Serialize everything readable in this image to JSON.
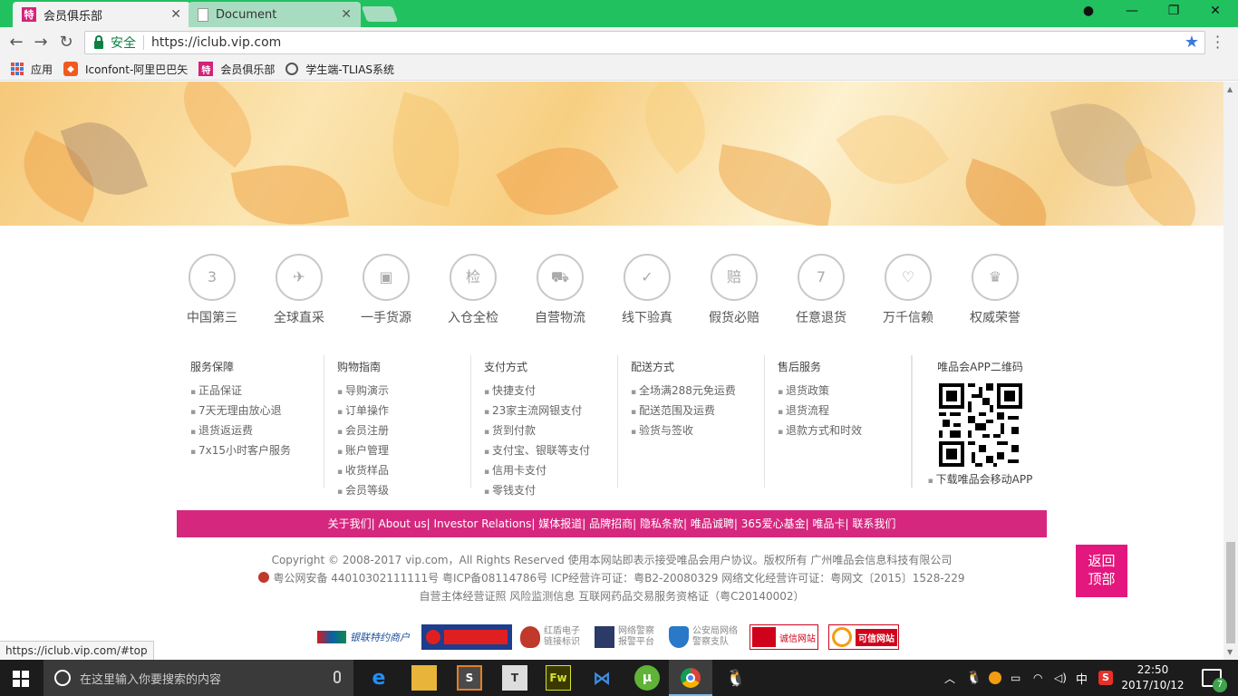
{
  "browser": {
    "tabs": [
      {
        "label": "会员俱乐部",
        "favicon": "vip-favicon",
        "favicon_text": "特"
      },
      {
        "label": "Document",
        "favicon": "document-icon"
      }
    ],
    "security_label": "安全",
    "url": "https://iclub.vip.com",
    "bookmarks": [
      {
        "label": "应用",
        "icon": "apps-grid-icon"
      },
      {
        "label": "Iconfont-阿里巴巴矢",
        "icon": "iconfont-icon"
      },
      {
        "label": "会员俱乐部",
        "icon": "vip-favicon",
        "icon_text": "特"
      },
      {
        "label": "学生端-TLIAS系统",
        "icon": "tlias-icon"
      }
    ],
    "status_url": "https://iclub.vip.com/#top"
  },
  "services": [
    {
      "label": "中国第三",
      "icon": "badge-3-icon",
      "glyph": "3"
    },
    {
      "label": "全球直采",
      "icon": "plane-globe-icon",
      "glyph": "✈"
    },
    {
      "label": "一手货源",
      "icon": "box-icon",
      "glyph": "▣"
    },
    {
      "label": "入仓全检",
      "icon": "inspect-magnifier-icon",
      "glyph": "检"
    },
    {
      "label": "自营物流",
      "icon": "truck-icon",
      "glyph": "⛟"
    },
    {
      "label": "线下验真",
      "icon": "document-check-icon",
      "glyph": "✓"
    },
    {
      "label": "假货必赔",
      "icon": "shield-compensate-icon",
      "glyph": "赔"
    },
    {
      "label": "任意退货",
      "icon": "return-7-icon",
      "glyph": "7"
    },
    {
      "label": "万千信赖",
      "icon": "heart-icon",
      "glyph": "♡"
    },
    {
      "label": "权威荣誉",
      "icon": "trophy-icon",
      "glyph": "♛"
    }
  ],
  "footer_columns": [
    {
      "title": "服务保障",
      "items": [
        "正品保证",
        "7天无理由放心退",
        "退货返运费",
        "7x15小时客户服务"
      ]
    },
    {
      "title": "购物指南",
      "items": [
        "导购演示",
        "订单操作",
        "会员注册",
        "账户管理",
        "收货样品",
        "会员等级"
      ]
    },
    {
      "title": "支付方式",
      "items": [
        "快捷支付",
        "23家主流网银支付",
        "货到付款",
        "支付宝、银联等支付",
        "信用卡支付",
        "零钱支付"
      ]
    },
    {
      "title": "配送方式",
      "items": [
        "全场满288元免运费",
        "配送范围及运费",
        "验货与签收"
      ]
    },
    {
      "title": "售后服务",
      "items": [
        "退货政策",
        "退货流程",
        "退款方式和时效"
      ]
    }
  ],
  "qr": {
    "title": "唯品会APP二维码",
    "caption": "下载唯品会移动APP"
  },
  "footer_nav": [
    "关于我们",
    "About us",
    "Investor Relations",
    "媒体报道",
    "品牌招商",
    "隐私条款",
    "唯品诚聘",
    "365爱心基金",
    "唯品卡",
    "联系我们"
  ],
  "copyright": {
    "line1": "Copyright © 2008-2017 vip.com，All Rights Reserved  使用本网站即表示接受唯品会用户协议。版权所有 广州唯品会信息科技有限公司",
    "line2": "粤公网安备 44010302111111号  粤ICP备08114786号 ICP经营许可证：粤B2-20080329 网络文化经营许可证：粤网文〔2015〕1528-229",
    "line3": "自营主体经营证照  风险监测信息  互联网药品交易服务资格证（粤C20140002）"
  },
  "back_to_top": {
    "line1": "返回",
    "line2": "顶部"
  },
  "badges": [
    {
      "label": "银联特约商户",
      "icon": "unionpay-icon"
    },
    {
      "label": "",
      "icon": "consumer-protection-icon"
    },
    {
      "label": "红盾电子\n链接标识",
      "icon": "red-shield-icon"
    },
    {
      "label": "网络警察\n报警平台",
      "icon": "cyber-police-icon"
    },
    {
      "label": "公安局网络\n警察支队",
      "icon": "police-shield-icon"
    },
    {
      "label": "诚信网站",
      "icon": "credit-website-icon"
    },
    {
      "label": "可信网站",
      "icon": "trusted-website-icon"
    }
  ],
  "taskbar": {
    "search_placeholder": "在这里输入你要搜索的内容",
    "ime": "中",
    "time": "22:50",
    "date": "2017/10/12",
    "notification_count": "7"
  },
  "colors": {
    "browser_green": "#21c160",
    "vip_pink": "#d6277f",
    "back_top_pink": "#e3177d"
  }
}
